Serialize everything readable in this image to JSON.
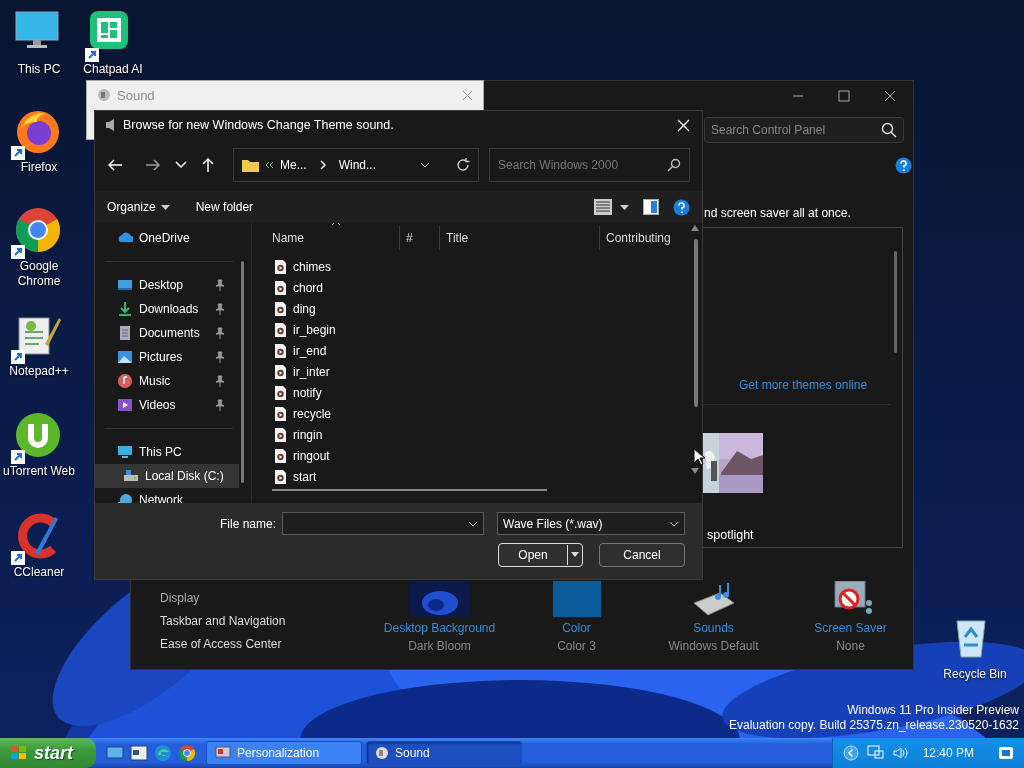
{
  "desktop_icons": [
    {
      "label": "This PC"
    },
    {
      "label": "Chatpad AI"
    },
    {
      "label": "Firefox"
    },
    {
      "label": "Google Chrome"
    },
    {
      "label": "Notepad++"
    },
    {
      "label": "uTorrent Web"
    },
    {
      "label": "CCleaner"
    },
    {
      "label": "Recycle Bin"
    }
  ],
  "personalization_window": {
    "search": {
      "placeholder": "Search Control Panel"
    },
    "description": "nd screen saver all at once.",
    "themes_link": "Get more themes online",
    "theme_label": "spotlight",
    "nav": [
      "Display",
      "Taskbar and Navigation",
      "Ease of Access Center"
    ],
    "settings": [
      {
        "title": "Desktop Background",
        "value": "Dark Bloom"
      },
      {
        "title": "Color",
        "value": "Color 3"
      },
      {
        "title": "Sounds",
        "value": "Windows Default"
      },
      {
        "title": "Screen Saver",
        "value": "None"
      }
    ]
  },
  "sound_window": {
    "title": "Sound"
  },
  "browse_dialog": {
    "title": "Browse for new Windows Change Theme sound.",
    "breadcrumb": [
      "Me...",
      "Wind..."
    ],
    "search": {
      "placeholder": "Search Windows 2000"
    },
    "toolbar": [
      "Organize",
      "New folder"
    ],
    "nav": [
      {
        "label": "OneDrive",
        "pinned": false,
        "selected": false
      },
      {
        "label": "Desktop",
        "pinned": true,
        "selected": false
      },
      {
        "label": "Downloads",
        "pinned": true,
        "selected": false
      },
      {
        "label": "Documents",
        "pinned": true,
        "selected": false
      },
      {
        "label": "Pictures",
        "pinned": true,
        "selected": false
      },
      {
        "label": "Music",
        "pinned": true,
        "selected": false
      },
      {
        "label": "Videos",
        "pinned": true,
        "selected": false
      },
      {
        "label": "This PC",
        "pinned": false,
        "selected": false,
        "children": [
          {
            "label": "Local Disk (C:)",
            "pinned": false,
            "selected": true
          }
        ]
      },
      {
        "label": "Network",
        "pinned": false,
        "selected": false
      }
    ],
    "columns": [
      "Name",
      "#",
      "Title",
      "Contributing"
    ],
    "files": [
      "chimes",
      "chord",
      "ding",
      "ir_begin",
      "ir_end",
      "ir_inter",
      "notify",
      "recycle",
      "ringin",
      "ringout",
      "start"
    ],
    "file_name_label": "File name:",
    "file_type": "Wave Files (*.wav)",
    "buttons": [
      "Open",
      "Cancel"
    ]
  },
  "taskbar": {
    "start": "start",
    "tasks": [
      {
        "label": "Personalization",
        "selected": false
      },
      {
        "label": "Sound",
        "selected": true
      }
    ],
    "clock": "12:40 PM"
  },
  "system_notice": [
    "Windows 11 Pro Insider Preview",
    "Evaluation copy. Build 25375.zn_release.230520-1632"
  ]
}
